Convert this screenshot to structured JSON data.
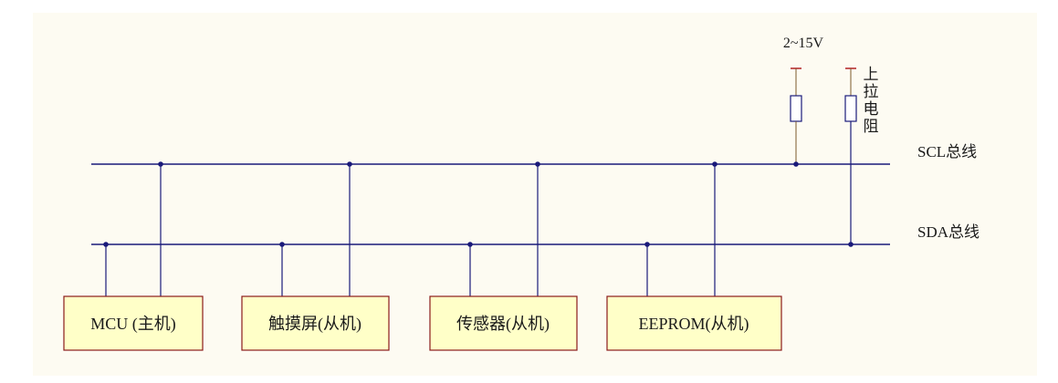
{
  "colors": {
    "page_background": "#ffffff",
    "panel_background": "#fdfbf2",
    "bus_line": "#1a1a7a",
    "device_box_fill": "#ffffc8",
    "device_box_border": "#8b1a1a",
    "resistor_lead": "#7a5a2a",
    "supply_tick": "#b22222",
    "text": "#1a1a1a"
  },
  "supply_label": "2~15V",
  "pullup_label": "上拉电阻",
  "buses": {
    "scl": "SCL总线",
    "sda": "SDA总线"
  },
  "devices": [
    {
      "label": "MCU (主机)"
    },
    {
      "label": "触摸屏(从机)"
    },
    {
      "label": "传感器(从机)"
    },
    {
      "label": "EEPROM(从机)"
    }
  ]
}
